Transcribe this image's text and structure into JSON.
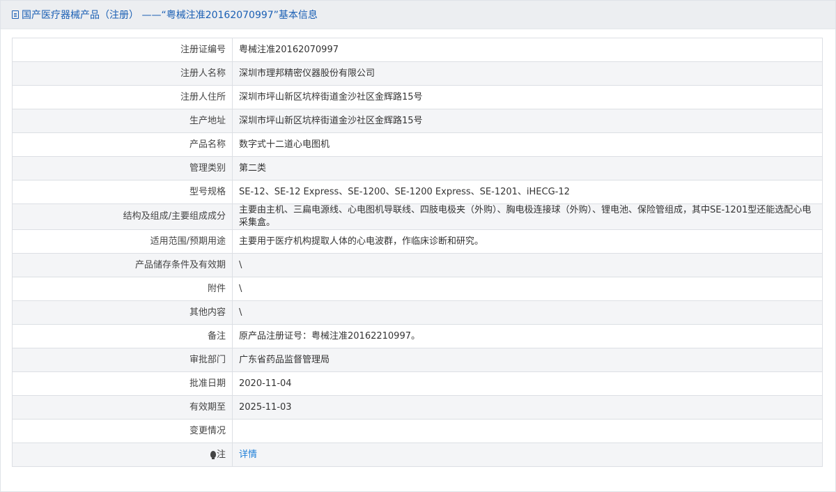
{
  "header": {
    "title": "国产医疗器械产品（注册） ——“粤械注准20162070997”基本信息"
  },
  "rows": [
    {
      "label": "注册证编号",
      "value": "粤械注准20162070997"
    },
    {
      "label": "注册人名称",
      "value": "深圳市理邦精密仪器股份有限公司"
    },
    {
      "label": "注册人住所",
      "value": "深圳市坪山新区坑梓街道金沙社区金辉路15号"
    },
    {
      "label": "生产地址",
      "value": "深圳市坪山新区坑梓街道金沙社区金辉路15号"
    },
    {
      "label": "产品名称",
      "value": "数字式十二道心电图机"
    },
    {
      "label": "管理类别",
      "value": "第二类"
    },
    {
      "label": "型号规格",
      "value": "SE-12、SE-12 Express、SE-1200、SE-1200 Express、SE-1201、iHECG-12"
    },
    {
      "label": "结构及组成/主要组成成分",
      "value": "主要由主机、三扁电源线、心电图机导联线、四肢电极夹（外购）、胸电极连接球（外购）、锂电池、保险管组成，其中SE-1201型还能选配心电采集盒。"
    },
    {
      "label": "适用范围/预期用途",
      "value": "主要用于医疗机构提取人体的心电波群，作临床诊断和研究。"
    },
    {
      "label": "产品储存条件及有效期",
      "value": "\\"
    },
    {
      "label": "附件",
      "value": "\\"
    },
    {
      "label": "其他内容",
      "value": "\\"
    },
    {
      "label": "备注",
      "value": "原产品注册证号：粤械注准20162210997。"
    },
    {
      "label": "审批部门",
      "value": "广东省药品监督管理局"
    },
    {
      "label": "批准日期",
      "value": "2020-11-04"
    },
    {
      "label": "有效期至",
      "value": "2025-11-03"
    },
    {
      "label": "变更情况",
      "value": ""
    },
    {
      "label": "注",
      "value": "详情"
    }
  ],
  "colors": {
    "header_text": "#1a5fb4",
    "link": "#1e7fd8"
  },
  "icons": {
    "header": "document-icon",
    "note": "lightbulb-icon"
  }
}
